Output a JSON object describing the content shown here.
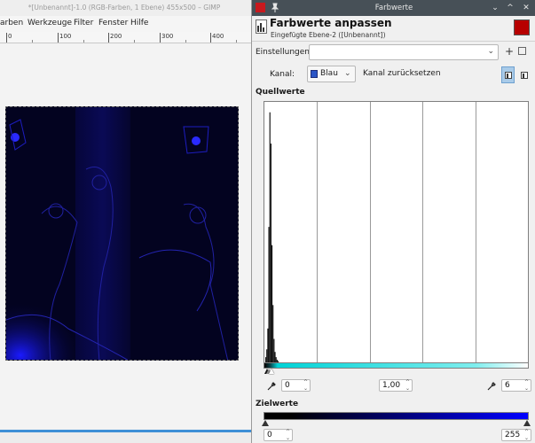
{
  "main_window": {
    "title": "*[Unbenannt]-1.0 (RGB-Farben, 1 Ebene) 455x500 – GIMP",
    "menu": [
      "arben",
      "Werkzeuge",
      "Filter",
      "Fenster",
      "Hilfe"
    ],
    "ruler_labels": [
      "0",
      "100",
      "200",
      "300",
      "400"
    ]
  },
  "dialog": {
    "window_title": "Farbwerte",
    "header_title": "Farbwerte anpassen",
    "header_subtitle": "Eingefügte Ebene-2 ([Unbenannt])",
    "presets_label": "Einstellungen:",
    "preset_value": "",
    "channel_label": "Kanal:",
    "channel_value": "Blau",
    "reset_channel_label": "Kanal zurücksetzen",
    "input_section_title": "Quellwerte",
    "output_section_title": "Zielwerte",
    "input_low": "0",
    "input_gamma": "1,00",
    "input_high": "6",
    "output_low": "0",
    "output_high": "255"
  },
  "histogram": {
    "channel": "blue",
    "bins_0_to_6": [
      0.02,
      0.05,
      0.13,
      0.52,
      0.96,
      0.84,
      0.45
    ],
    "tail_bins_7_to_12": [
      0.22,
      0.09,
      0.04,
      0.02,
      0.01,
      0.005
    ],
    "range": [
      0,
      255
    ],
    "grid_divisions": 5
  },
  "colors": {
    "dialog_titlebar": "#475057",
    "selection_accent": "#3d8fd6",
    "image_blue": "#0000ff"
  }
}
